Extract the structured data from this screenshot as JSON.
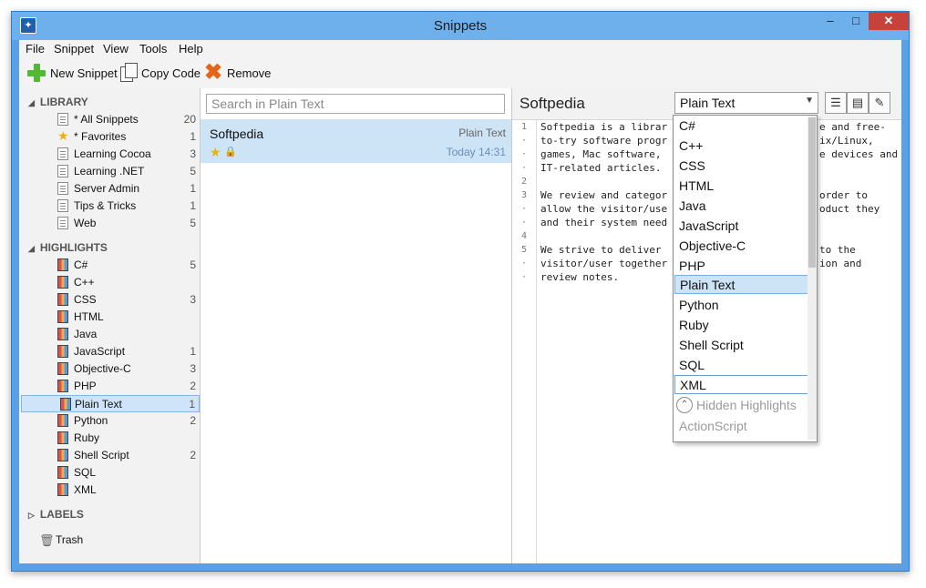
{
  "window": {
    "title": "Snippets",
    "minimize": "–",
    "maximize": "□",
    "close": "✕"
  },
  "menu": [
    "File",
    "Snippet",
    "View",
    "Tools",
    "Help"
  ],
  "toolbar": {
    "new": "New Snippet",
    "copy": "Copy Code",
    "remove": "Remove"
  },
  "sidebar": {
    "library_label": "LIBRARY",
    "library": [
      {
        "label": "* All Snippets",
        "count": "20",
        "icon": "notes-icon"
      },
      {
        "label": "* Favorites",
        "count": "1",
        "icon": "star-icon"
      },
      {
        "label": "Learning Cocoa",
        "count": "3",
        "icon": "note-icon"
      },
      {
        "label": "Learning .NET",
        "count": "5",
        "icon": "note-icon"
      },
      {
        "label": "Server Admin",
        "count": "1",
        "icon": "note-icon"
      },
      {
        "label": "Tips & Tricks",
        "count": "1",
        "icon": "note-icon"
      },
      {
        "label": "Web",
        "count": "5",
        "icon": "note-icon"
      }
    ],
    "highlights_label": "HIGHLIGHTS",
    "highlights": [
      {
        "label": "C#",
        "count": "5"
      },
      {
        "label": "C++",
        "count": ""
      },
      {
        "label": "CSS",
        "count": "3"
      },
      {
        "label": "HTML",
        "count": ""
      },
      {
        "label": "Java",
        "count": ""
      },
      {
        "label": "JavaScript",
        "count": "1"
      },
      {
        "label": "Objective-C",
        "count": "3"
      },
      {
        "label": "PHP",
        "count": "2"
      },
      {
        "label": "Plain Text",
        "count": "1"
      },
      {
        "label": "Python",
        "count": "2"
      },
      {
        "label": "Ruby",
        "count": ""
      },
      {
        "label": "Shell Script",
        "count": "2"
      },
      {
        "label": "SQL",
        "count": ""
      },
      {
        "label": "XML",
        "count": ""
      }
    ],
    "labels_label": "LABELS",
    "trash": "Trash"
  },
  "list": {
    "search_placeholder": "Search in Plain Text",
    "snippet": {
      "name": "Softpedia",
      "lang": "Plain Text",
      "date": "Today 14:31"
    }
  },
  "editor": {
    "title": "Softpedia",
    "language": "Plain Text",
    "gutter": [
      "1",
      "·",
      "·",
      "·",
      "2",
      "3",
      "·",
      "·",
      "4",
      "5",
      "·",
      "·"
    ],
    "lines": [
      "Softpedia is a librar",
      "to-try software progr",
      "games, Mac software, ",
      "IT-related articles.",
      "",
      "We review and categor",
      "allow the visitor/use",
      "and their system need",
      "",
      "We strive to deliver ",
      "visitor/user together",
      "review notes."
    ],
    "right_text": [
      "e and free-",
      "ix/Linux,",
      "e devices and",
      "",
      "",
      "order to",
      "oduct they",
      "",
      "",
      "to the",
      "ion and",
      ""
    ]
  },
  "dropdown": {
    "items": [
      "C#",
      "C++",
      "CSS",
      "HTML",
      "Java",
      "JavaScript",
      "Objective-C",
      "PHP",
      "Plain Text",
      "Python",
      "Ruby",
      "Shell Script",
      "SQL",
      "XML"
    ],
    "section": "Hidden Highlights",
    "hidden": [
      "ActionScript"
    ]
  }
}
